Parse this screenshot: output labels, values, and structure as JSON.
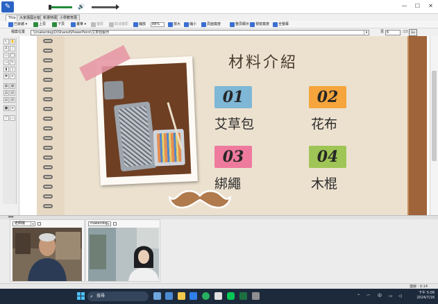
{
  "tabs": [
    {
      "label": "Title"
    },
    {
      "label": "大家講國台客"
    },
    {
      "label": "新選特展"
    },
    {
      "label": "小學教育展"
    }
  ],
  "toolbar": {
    "items": [
      {
        "label": "已就緒",
        "icon": "document-icon",
        "color": "#3a6fd1"
      },
      {
        "label": "上頁",
        "icon": "prev-page-icon",
        "color": "#2e8b3e"
      },
      {
        "label": "下頁",
        "icon": "next-page-icon",
        "color": "#2e8b3e"
      },
      {
        "label": "畫筆",
        "icon": "pen-icon",
        "color": "#3a6fd1"
      },
      {
        "label": "復原",
        "icon": "undo-icon",
        "color": "#9a9a9a",
        "disabled": true
      },
      {
        "label": "取消復原",
        "icon": "redo-icon",
        "color": "#9a9a9a",
        "disabled": true
      },
      {
        "label": "縮放",
        "icon": "zoom-icon",
        "color": "#3a6fd1"
      },
      {
        "label": "放大",
        "icon": "zoom-in-icon",
        "color": "#3a6fd1"
      },
      {
        "label": "縮小",
        "icon": "zoom-out-icon",
        "color": "#3a6fd1"
      },
      {
        "label": "頁面寬度",
        "icon": "fit-width-icon",
        "color": "#3a6fd1"
      },
      {
        "label": "整頁顯示",
        "icon": "fit-page-icon",
        "color": "#3a6fd1"
      },
      {
        "label": "視窗寬度",
        "icon": "window-width-icon",
        "color": "#3a6fd1"
      },
      {
        "label": "全螢幕",
        "icon": "fullscreen-icon",
        "color": "#3a6fd1"
      }
    ],
    "zoom_value": "88%"
  },
  "address": {
    "label": "檔案位置",
    "value": "\\\\makerdog\\D\\Shared\\PowerPoint\\艾草包製作",
    "page_label": "頁",
    "page_value": "6",
    "page_total": "/15",
    "go_label": "Go"
  },
  "slide": {
    "title": "材料介紹",
    "items": [
      {
        "num": "01",
        "text": "艾草包",
        "color": "#7fb7d6"
      },
      {
        "num": "02",
        "text": "花布",
        "color": "#f5a53c"
      },
      {
        "num": "03",
        "text": "綁繩",
        "color": "#ee7a9e"
      },
      {
        "num": "04",
        "text": "木棍",
        "color": "#9fc556"
      }
    ]
  },
  "videos": [
    {
      "name": "老師機"
    },
    {
      "name": "makerdog"
    }
  ],
  "status": {
    "text": "連線 · 0:14"
  },
  "taskbar": {
    "search_placeholder": "搜尋",
    "tray_lang": "中",
    "time": "下午 5:09",
    "date": "2024/7/16"
  }
}
